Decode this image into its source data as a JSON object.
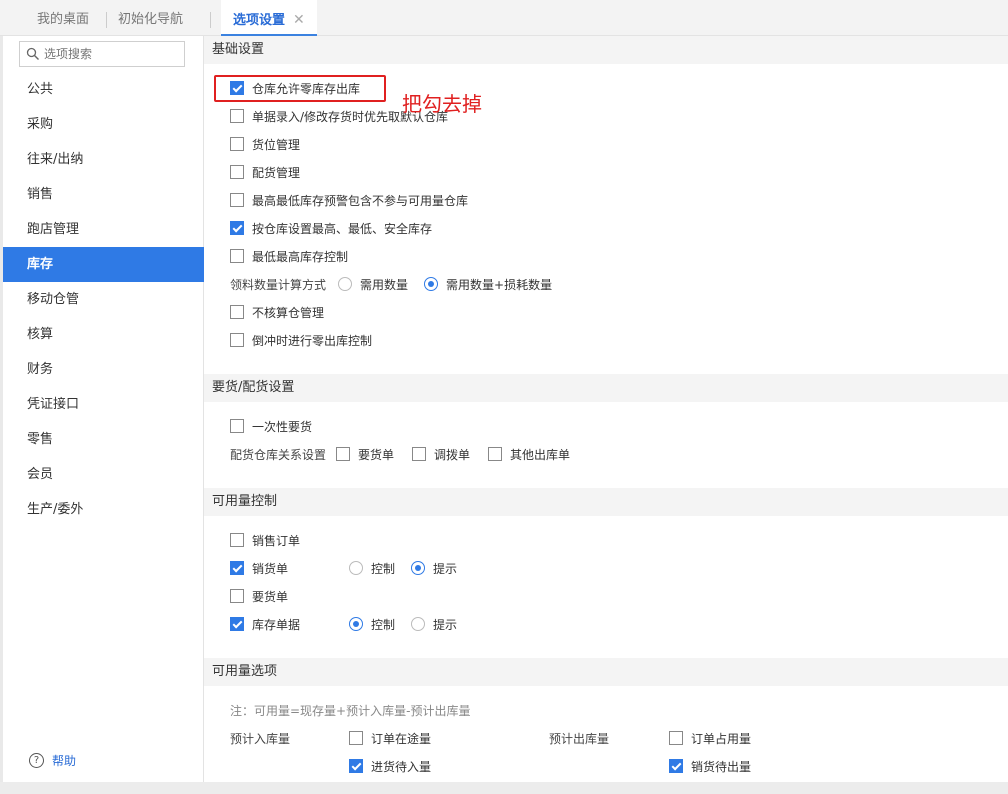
{
  "tabs": {
    "desktop": "我的桌面",
    "init_nav": "初始化导航",
    "options": "选项设置",
    "close": "✕"
  },
  "sidebar": {
    "search_placeholder": "选项搜索",
    "items": [
      "公共",
      "采购",
      "往来/出纳",
      "销售",
      "跑店管理",
      "库存",
      "移动仓管",
      "核算",
      "财务",
      "凭证接口",
      "零售",
      "会员",
      "生产/委外"
    ],
    "active_index": 5,
    "help": "帮助"
  },
  "sections": {
    "basic": {
      "title": "基础设置",
      "items": [
        {
          "label": "仓库允许零库存出库",
          "checked": true
        },
        {
          "label": "单据录入/修改存货时优先取默认仓库",
          "checked": false
        },
        {
          "label": "货位管理",
          "checked": false
        },
        {
          "label": "配货管理",
          "checked": false
        },
        {
          "label": "最高最低库存预警包含不参与可用量仓库",
          "checked": false
        },
        {
          "label": "按仓库设置最高、最低、安全库存",
          "checked": true
        },
        {
          "label": "最低最高库存控制",
          "checked": false
        }
      ],
      "material_calc": {
        "label": "领料数量计算方式",
        "opt1": "需用数量",
        "opt2": "需用数量+损耗数量",
        "selected": 2
      },
      "items2": [
        {
          "label": "不核算仓管理",
          "checked": false
        },
        {
          "label": "倒冲时进行零出库控制",
          "checked": false
        }
      ]
    },
    "requisition": {
      "title": "要货/配货设置",
      "once": {
        "label": "一次性要货",
        "checked": false
      },
      "relation_label": "配货仓库关系设置",
      "relation_opts": [
        {
          "label": "要货单",
          "checked": false
        },
        {
          "label": "调拨单",
          "checked": false
        },
        {
          "label": "其他出库单",
          "checked": false
        }
      ]
    },
    "availability": {
      "title": "可用量控制",
      "rows": [
        {
          "label": "销售订单",
          "checked": false,
          "has_radio": false
        },
        {
          "label": "销货单",
          "checked": true,
          "has_radio": true,
          "control": "控制",
          "hint": "提示",
          "selected": "hint"
        },
        {
          "label": "要货单",
          "checked": false,
          "has_radio": false
        },
        {
          "label": "库存单据",
          "checked": true,
          "has_radio": true,
          "control": "控制",
          "hint": "提示",
          "selected": "control"
        }
      ]
    },
    "avail_options": {
      "title": "可用量选项",
      "note": "注：可用量=现存量+预计入库量-预计出库量",
      "incoming_label": "预计入库量",
      "outgoing_label": "预计出库量",
      "incoming": [
        {
          "label": "订单在途量",
          "checked": false
        },
        {
          "label": "进货待入量",
          "checked": true
        }
      ],
      "outgoing": [
        {
          "label": "订单占用量",
          "checked": false
        },
        {
          "label": "销货待出量",
          "checked": true
        }
      ]
    }
  },
  "annotation": {
    "text": "把勾去掉",
    "color": "#e02020"
  },
  "colors": {
    "accent": "#2f7ae5",
    "tab_active": "#2a6cd6"
  }
}
